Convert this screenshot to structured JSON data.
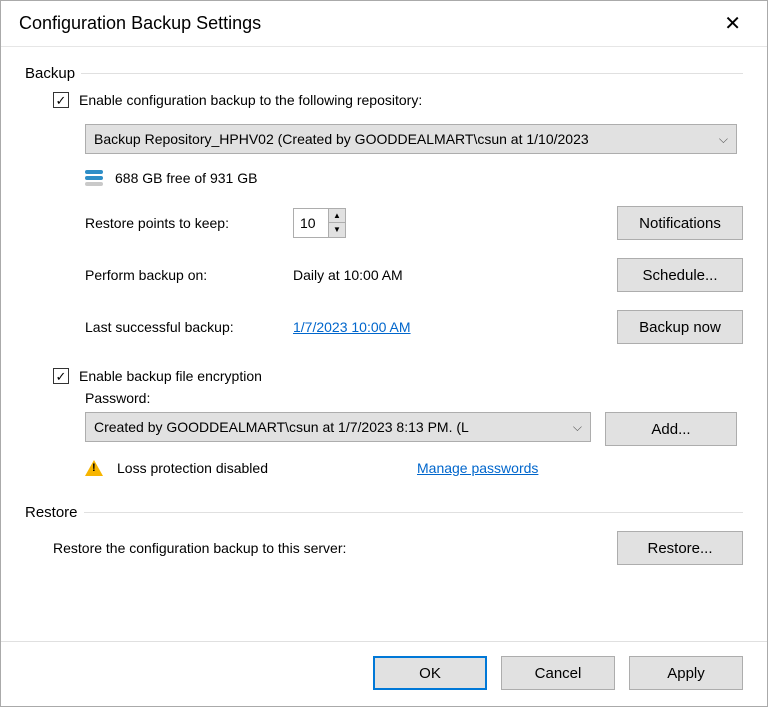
{
  "title": "Configuration Backup Settings",
  "backup": {
    "section_label": "Backup",
    "enable_label": "Enable configuration backup to the following repository:",
    "repository": "Backup Repository_HPHV02 (Created by GOODDEALMART\\csun at 1/10/2023",
    "free_space": "688 GB free of 931 GB",
    "restore_points_label": "Restore points to keep:",
    "restore_points_value": "10",
    "notifications_btn": "Notifications",
    "perform_label": "Perform backup on:",
    "perform_value": "Daily at 10:00 AM",
    "schedule_btn": "Schedule...",
    "last_label": "Last successful backup:",
    "last_value": "1/7/2023 10:00 AM",
    "backup_now_btn": "Backup now",
    "enable_encryption_label": "Enable backup file encryption",
    "password_label": "Password:",
    "password_value": "Created by GOODDEALMART\\csun at 1/7/2023 8:13 PM. (L",
    "add_btn": "Add...",
    "loss_protection": "Loss protection disabled",
    "manage_passwords": "Manage passwords"
  },
  "restore": {
    "section_label": "Restore",
    "text": "Restore the configuration backup to this server:",
    "restore_btn": "Restore..."
  },
  "buttons": {
    "ok": "OK",
    "cancel": "Cancel",
    "apply": "Apply"
  }
}
